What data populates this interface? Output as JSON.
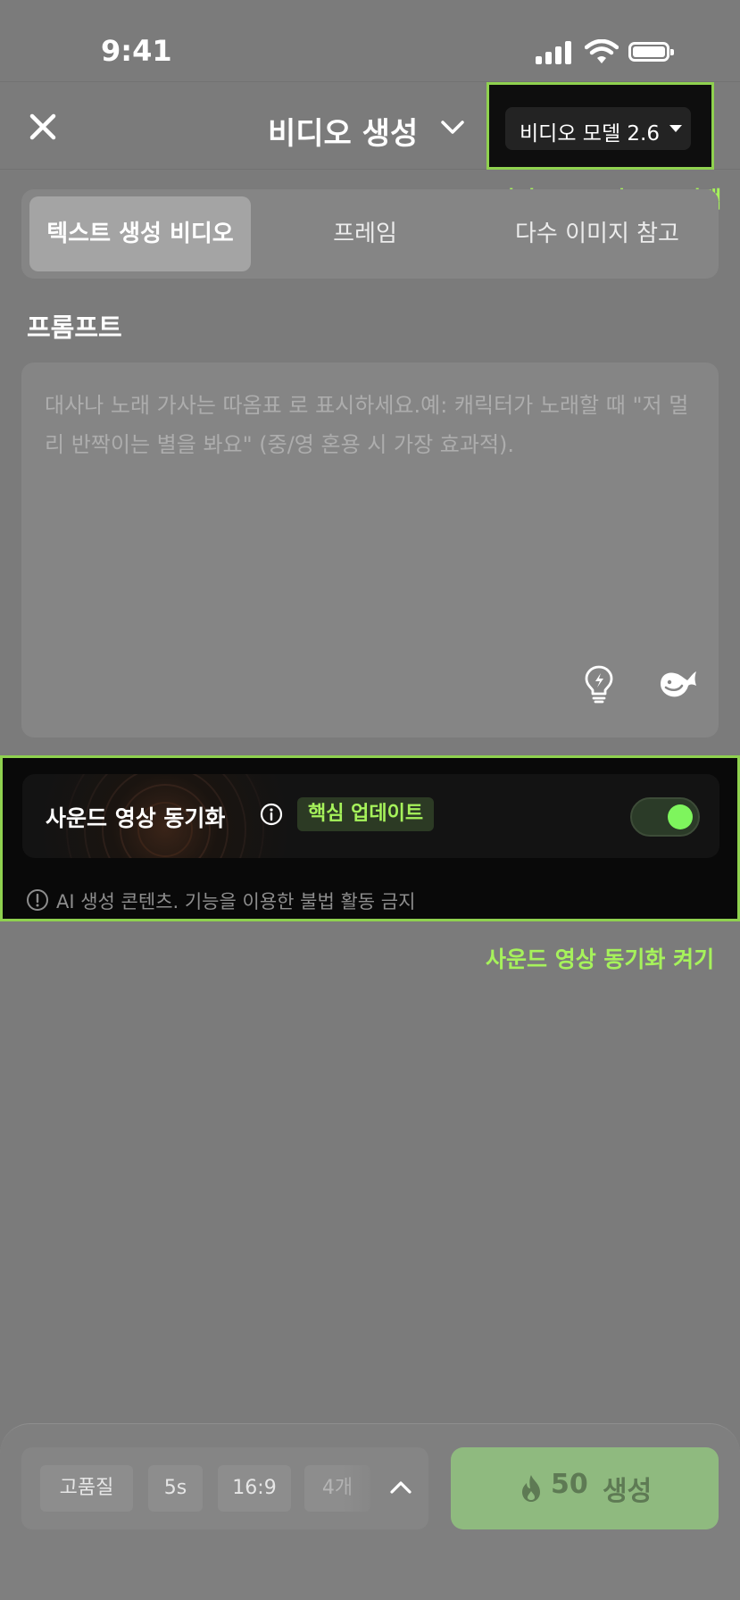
{
  "status_bar": {
    "time": "9:41"
  },
  "header": {
    "title": "비디오 생성",
    "model_selector": {
      "label": "비디오 모델 2.6"
    }
  },
  "annotations": {
    "model": "비디오 프로필 2.6 선택",
    "sound": "사운드 영상 동기화 켜기"
  },
  "tabs": [
    {
      "label": "텍스트 생성 비디오",
      "active": true
    },
    {
      "label": "프레임",
      "active": false
    },
    {
      "label": "다수 이미지 참고",
      "active": false
    }
  ],
  "prompt": {
    "label": "프롬프트",
    "placeholder": "대사나 노래 가사는 따옴표 로 표시하세요.예: 캐릭터가 노래할 때 \"저 멀리 반짝이는 별을 봐요\" (중/영 혼용 시 가장 효과적)."
  },
  "sound_sync": {
    "label": "사운드 영상 동기화",
    "badge": "핵심 업데이트",
    "enabled": true
  },
  "disclaimer": "AI 생성 콘텐츠. 기능을 이용한 불법 활동 금지",
  "options": {
    "quality": "고품질",
    "duration": "5s",
    "ratio": "16:9",
    "count": "4개"
  },
  "generate": {
    "cost": "50",
    "label": "생성"
  },
  "colors": {
    "accent_green": "#a6f25b",
    "highlight_border": "#8fd14f",
    "toggle_on": "#7ef55d",
    "generate_button": "#8fba7f"
  }
}
